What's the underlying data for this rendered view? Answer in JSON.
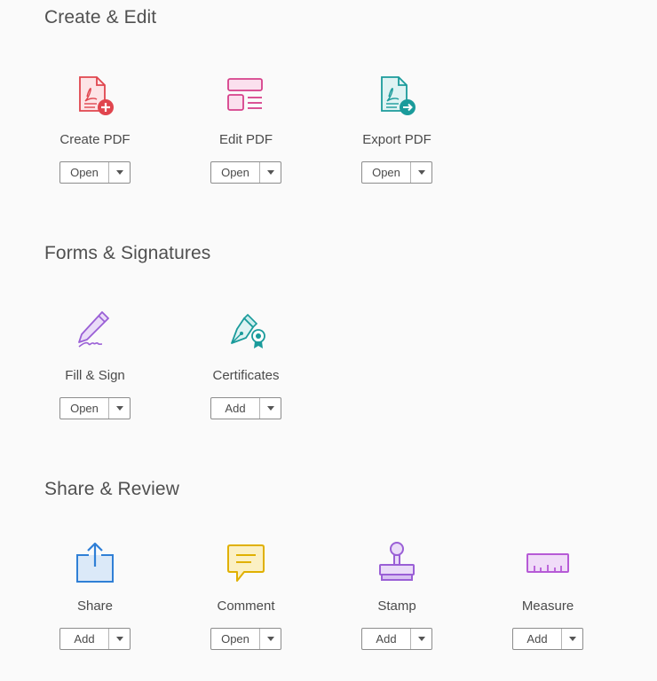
{
  "sections": [
    {
      "title": "Create & Edit",
      "tools": [
        {
          "label": "Create PDF",
          "button": "Open",
          "icon": "create-pdf-icon",
          "color": "#e0454e"
        },
        {
          "label": "Edit PDF",
          "button": "Open",
          "icon": "edit-pdf-icon",
          "color": "#d6408a"
        },
        {
          "label": "Export PDF",
          "button": "Open",
          "icon": "export-pdf-icon",
          "color": "#1a9b9b"
        }
      ]
    },
    {
      "title": "Forms & Signatures",
      "tools": [
        {
          "label": "Fill & Sign",
          "button": "Open",
          "icon": "fill-sign-icon",
          "color": "#9a5fd6"
        },
        {
          "label": "Certificates",
          "button": "Add",
          "icon": "certificates-icon",
          "color": "#1a9b9b"
        }
      ]
    },
    {
      "title": "Share & Review",
      "tools": [
        {
          "label": "Share",
          "button": "Add",
          "icon": "share-icon",
          "color": "#2f7fd6"
        },
        {
          "label": "Comment",
          "button": "Open",
          "icon": "comment-icon",
          "color": "#e0b000"
        },
        {
          "label": "Stamp",
          "button": "Add",
          "icon": "stamp-icon",
          "color": "#9a5fd6"
        },
        {
          "label": "Measure",
          "button": "Add",
          "icon": "measure-icon",
          "color": "#b65ad6"
        }
      ]
    }
  ]
}
